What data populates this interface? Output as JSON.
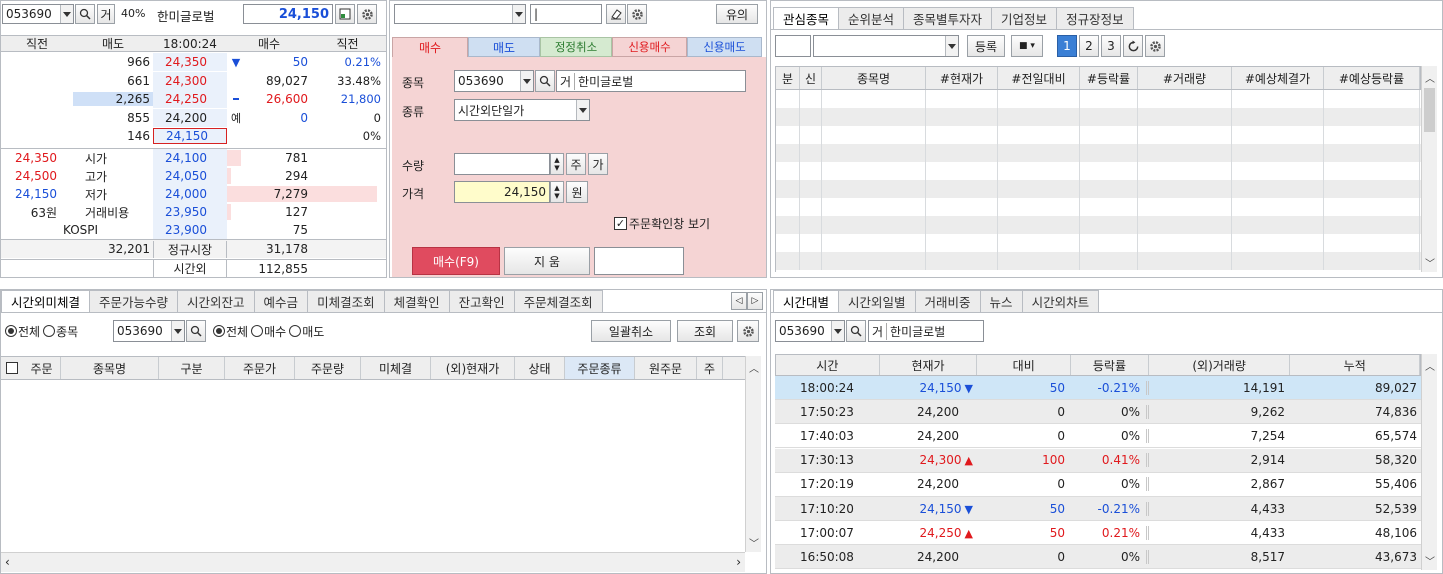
{
  "top_left": {
    "code": "053690",
    "market_tag": "거",
    "margin": "40%",
    "name": "한미글로벌",
    "price": "24,150"
  },
  "top_mid": {
    "notice_button": "유의"
  },
  "orderbook": {
    "headers": [
      "직전",
      "매도",
      "18:00:24",
      "매수",
      "직전"
    ],
    "ask_rows": [
      {
        "qty": "966",
        "price": "24,350",
        "flag": "",
        "bid": "",
        "bidcolor": "",
        "pct": ""
      },
      {
        "qty": "661",
        "price": "24,300",
        "flag": "",
        "bid": "",
        "bidcolor": "",
        "pct": ""
      },
      {
        "qty": "2,265",
        "price": "24,250",
        "flag": "",
        "bid": "",
        "bidcolor": "",
        "pct": ""
      },
      {
        "qty": "855",
        "price": "24,200",
        "flag": "",
        "bid": "",
        "bidcolor": "",
        "pct": ""
      },
      {
        "qty": "146",
        "price": "24,150",
        "flag": "",
        "bid": "",
        "bidcolor": "",
        "pct": ""
      }
    ],
    "right_block": [
      {
        "flag": "▼",
        "val": "50",
        "pct": "0.21%"
      },
      {
        "flag": "",
        "val": "89,027",
        "pct": "33.48%"
      },
      {
        "flag": "",
        "val": "26,600",
        "pct": "21,800"
      },
      {
        "flag": "예",
        "val": "0",
        "pct": "0"
      },
      {
        "flag": "",
        "val": "",
        "pct": "0%"
      }
    ],
    "info_rows": [
      {
        "lv": "24,350",
        "lt": "시가",
        "price": "24,100",
        "bid": "781"
      },
      {
        "lv": "24,500",
        "lt": "고가",
        "price": "24,050",
        "bid": "294"
      },
      {
        "lv": "24,150",
        "lt": "저가",
        "price": "24,000",
        "bid": "7,279"
      },
      {
        "lv": "63원",
        "lt": "거래비용",
        "price": "23,950",
        "bid": "127"
      },
      {
        "lv": "",
        "lt": "KOSPI",
        "price": "23,900",
        "bid": "75"
      }
    ],
    "total_ask": "32,201",
    "total_label": "정규시장",
    "total_bid": "31,178",
    "after_label": "시간외",
    "after_bid": "112,855"
  },
  "order": {
    "tabs": [
      "매수",
      "매도",
      "정정취소",
      "신용매수",
      "신용매도"
    ],
    "label_stock": "종목",
    "code": "053690",
    "market_tag": "거",
    "name": "한미글로벌",
    "label_type": "종류",
    "type_value": "시간외단일가",
    "label_qty": "수량",
    "qty_unit1": "주",
    "qty_unit2": "가",
    "label_price": "가격",
    "price_value": "24,150",
    "price_unit": "원",
    "confirm_label": "주문확인창 보기",
    "buy_button": "매수(F9)",
    "clear_button": "지 움"
  },
  "watch": {
    "tabs": [
      "관심종목",
      "순위분석",
      "종목별투자자",
      "기업정보",
      "정규장정보"
    ],
    "register_button": "등록",
    "pages": [
      "1",
      "2",
      "3"
    ],
    "headers": [
      "분",
      "신",
      "종목명",
      "#현재가",
      "#전일대비",
      "#등락률",
      "#거래량",
      "#예상체결가",
      "#예상등락률"
    ]
  },
  "pending": {
    "tabs": [
      "시간외미체결",
      "주문가능수량",
      "시간외잔고",
      "예수금",
      "미체결조회",
      "체결확인",
      "잔고확인",
      "주문체결조회"
    ],
    "radio1": [
      "전체",
      "종목"
    ],
    "code": "053690",
    "radio2": [
      "전체",
      "매수",
      "매도"
    ],
    "cancel_all": "일괄취소",
    "query": "조회",
    "headers": [
      "주문",
      "종목명",
      "구분",
      "주문가",
      "주문량",
      "미체결",
      "(외)현재가",
      "상태",
      "주문종류",
      "원주문",
      "주"
    ]
  },
  "timeline": {
    "tabs": [
      "시간대별",
      "시간외일별",
      "거래비중",
      "뉴스",
      "시간외차트"
    ],
    "code": "053690",
    "market_tag": "거",
    "name": "한미글로벌",
    "headers": [
      "시간",
      "현재가",
      "대비",
      "등락률",
      "(외)거래량",
      "누적"
    ],
    "rows": [
      {
        "time": "18:00:24",
        "price": "24,150",
        "dir": "down",
        "diff": "50",
        "rate": "-0.21%",
        "vol": "14,191",
        "cum": "89,027"
      },
      {
        "time": "17:50:23",
        "price": "24,200",
        "dir": "",
        "diff": "0",
        "rate": "0%",
        "vol": "9,262",
        "cum": "74,836"
      },
      {
        "time": "17:40:03",
        "price": "24,200",
        "dir": "",
        "diff": "0",
        "rate": "0%",
        "vol": "7,254",
        "cum": "65,574"
      },
      {
        "time": "17:30:13",
        "price": "24,300",
        "dir": "up",
        "diff": "100",
        "rate": "0.41%",
        "vol": "2,914",
        "cum": "58,320"
      },
      {
        "time": "17:20:19",
        "price": "24,200",
        "dir": "",
        "diff": "0",
        "rate": "0%",
        "vol": "2,867",
        "cum": "55,406"
      },
      {
        "time": "17:10:20",
        "price": "24,150",
        "dir": "down",
        "diff": "50",
        "rate": "-0.21%",
        "vol": "4,433",
        "cum": "52,539"
      },
      {
        "time": "17:00:07",
        "price": "24,250",
        "dir": "up",
        "diff": "50",
        "rate": "0.21%",
        "vol": "4,433",
        "cum": "48,106"
      },
      {
        "time": "16:50:08",
        "price": "24,200",
        "dir": "",
        "diff": "0",
        "rate": "0%",
        "vol": "8,517",
        "cum": "43,673"
      }
    ]
  },
  "colors": {
    "up": "#e0191d",
    "down": "#1a4fd8",
    "order_panel_bg": "#f5d4d4",
    "buy_button": "#e04b5f",
    "highlight_row": "#cfe6f7"
  },
  "icons": [
    "search-icon",
    "gear-icon",
    "eraser-icon",
    "refresh-icon",
    "dropdown-icon"
  ]
}
